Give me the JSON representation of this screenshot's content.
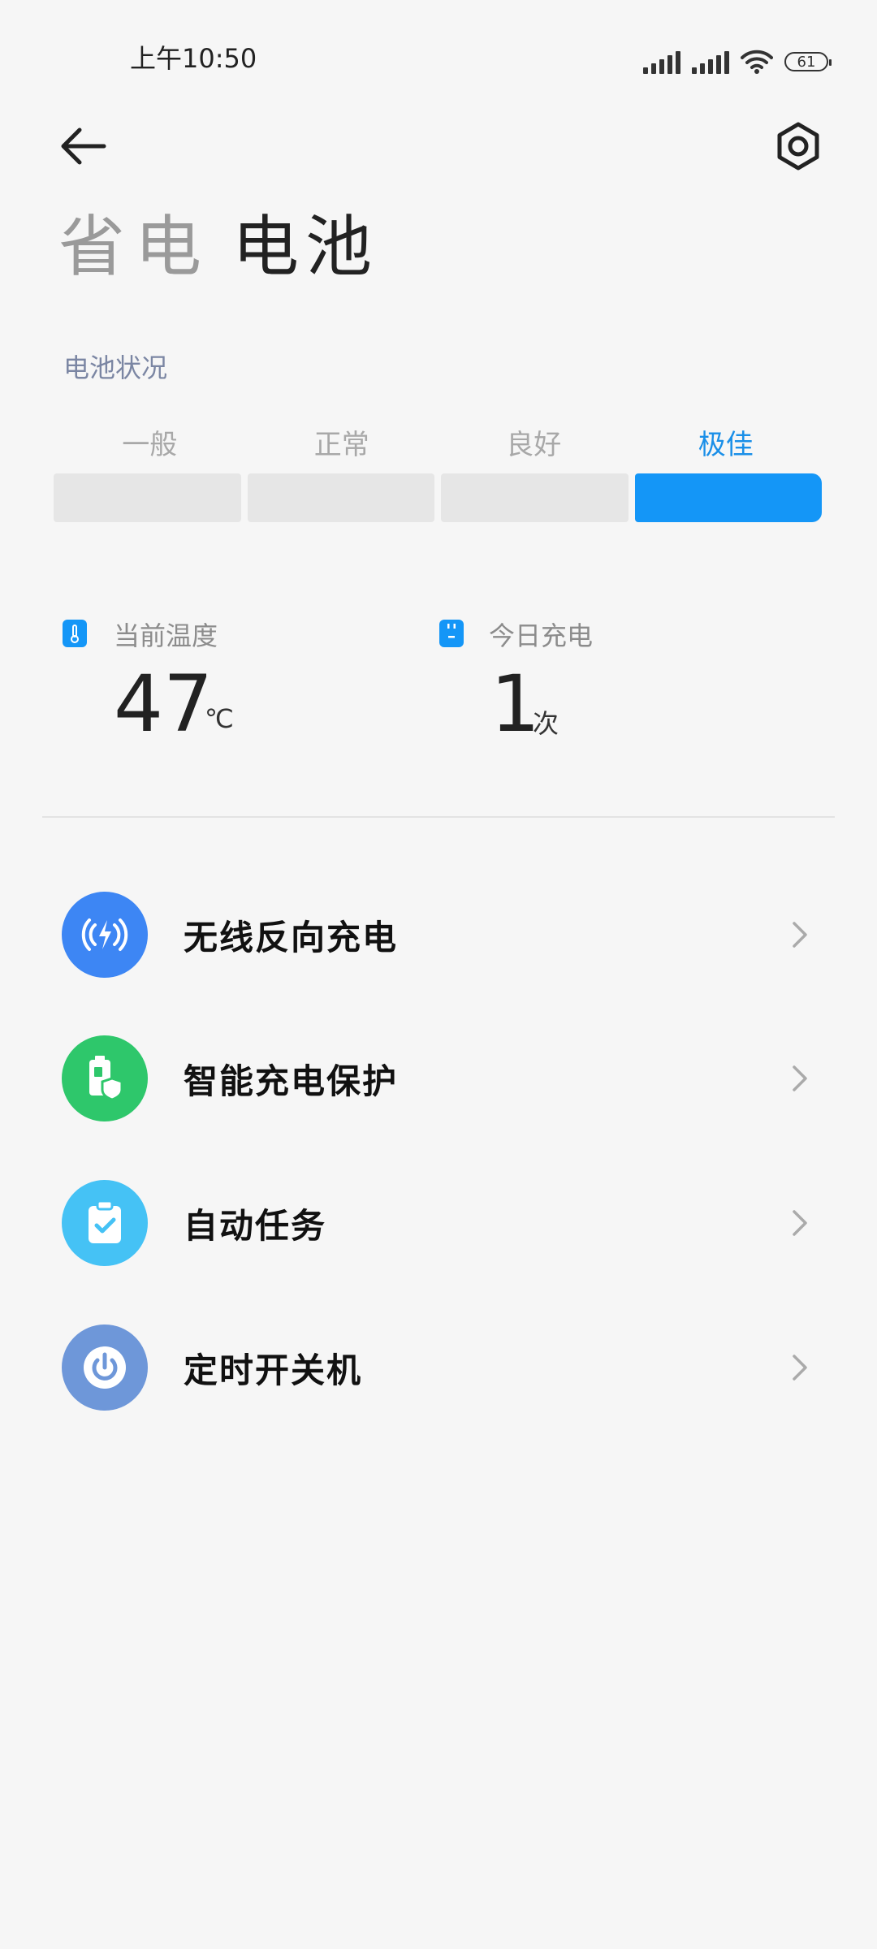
{
  "status_bar": {
    "time": "上午10:50",
    "battery_level": "61"
  },
  "header": {
    "tab_power_saving": "省电",
    "tab_battery": "电池"
  },
  "battery_health": {
    "section_label": "电池状况",
    "levels": [
      "一般",
      "正常",
      "良好",
      "极佳"
    ],
    "active_level": "极佳",
    "active_color": "#1496f7"
  },
  "stats": {
    "temperature": {
      "label": "当前温度",
      "value": "47",
      "unit": "℃"
    },
    "charges_today": {
      "label": "今日充电",
      "value": "1",
      "unit": "次"
    }
  },
  "menu": {
    "items": [
      {
        "label": "无线反向充电",
        "icon": "wireless-charge-icon",
        "color": "#3d86f4"
      },
      {
        "label": "智能充电保护",
        "icon": "battery-shield-icon",
        "color": "#2ec76b"
      },
      {
        "label": "自动任务",
        "icon": "clipboard-check-icon",
        "color": "#45c2f5"
      },
      {
        "label": "定时开关机",
        "icon": "power-icon",
        "color": "#6e97d9"
      }
    ]
  }
}
